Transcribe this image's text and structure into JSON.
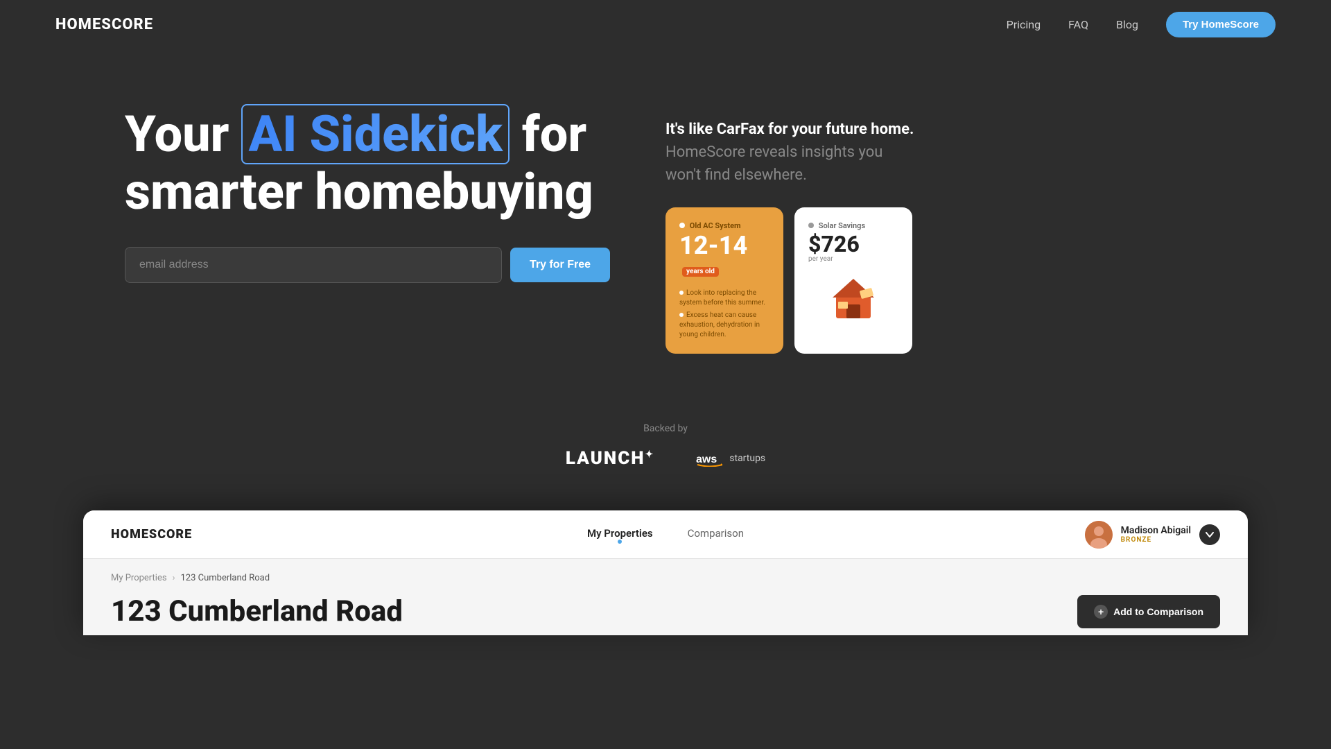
{
  "navbar": {
    "logo": "HOMESCORE",
    "links": [
      {
        "label": "Pricing",
        "id": "pricing"
      },
      {
        "label": "FAQ",
        "id": "faq"
      },
      {
        "label": "Blog",
        "id": "blog"
      }
    ],
    "cta_label": "Try HomeScore"
  },
  "hero": {
    "headline_prefix": "Your",
    "headline_highlight": "AI Sidekick",
    "headline_suffix": "for smarter homebuying",
    "email_placeholder": "email address",
    "cta_label": "Try for Free",
    "tagline_bold": "It's like CarFax for your future home.",
    "tagline_soft": "HomeScore reveals insights you won't find elsewhere.",
    "card_ac": {
      "label": "Old AC System",
      "number": "12-14",
      "badge": "years old",
      "text1": "Look into replacing the system before this summer.",
      "text2": "Excess heat can cause exhaustion, dehydration in young children."
    },
    "card_solar": {
      "label": "Solar Savings",
      "amount": "$726",
      "period": "per year"
    }
  },
  "backed": {
    "label": "Backed by",
    "logos": [
      {
        "name": "LAUNCH+",
        "id": "launch"
      },
      {
        "name": "aws startups",
        "id": "aws"
      }
    ]
  },
  "app": {
    "logo": "HOMESCORE",
    "nav_links": [
      {
        "label": "My Properties",
        "active": true
      },
      {
        "label": "Comparison",
        "active": false
      }
    ],
    "user": {
      "name": "Madison Abigail",
      "badge": "BRONZE"
    },
    "breadcrumb": {
      "parent": "My Properties",
      "current": "123 Cumberland Road"
    },
    "property_title": "123 Cumberland Road",
    "add_compare_label": "Add to Comparison"
  }
}
